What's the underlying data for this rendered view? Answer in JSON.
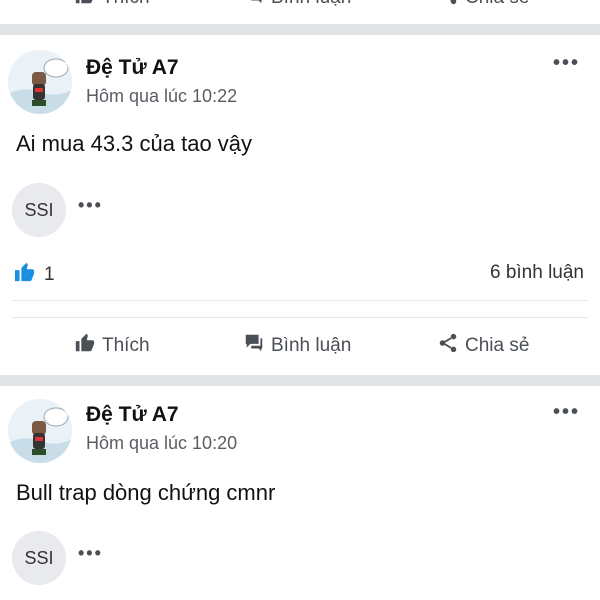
{
  "top_bar": {
    "like_label": "Thích",
    "comment_label": "Bình luận",
    "share_label": "Chia sẻ"
  },
  "posts": [
    {
      "author": "Đệ Tử A7",
      "time": "Hôm qua lúc 10:22",
      "text": "Ai mua 43.3 của tao vậy",
      "tag_chip": "SSI",
      "like_count": "1",
      "comment_count": "6 bình luận",
      "actions": {
        "like_label": "Thích",
        "comment_label": "Bình luận",
        "share_label": "Chia sẻ"
      }
    },
    {
      "author": "Đệ Tử A7",
      "time": "Hôm qua lúc 10:20",
      "text": "Bull trap dòng chứng cmnr",
      "tag_chip": "SSI"
    }
  ],
  "colors": {
    "like_blue": "#1b8fe0",
    "separator": "#e3e4e6",
    "muted_text": "#5a5d63"
  },
  "icons": {
    "like": "thumbs-up-icon",
    "comment": "chat-bubble-icon",
    "share": "share-icon",
    "more": "more-dots-icon"
  }
}
